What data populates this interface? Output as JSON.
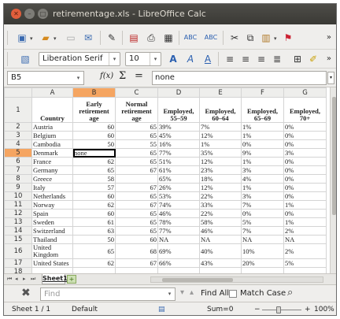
{
  "window": {
    "title": "retirementage.xls - LibreOffice Calc"
  },
  "toolbar": {
    "font_name": "Liberation Serif",
    "font_size": "10",
    "more": "»"
  },
  "formula_bar": {
    "cell_ref": "B5",
    "fx_label": "f(x)",
    "sum_label": "Σ",
    "equals_label": "=",
    "content": "none"
  },
  "grid": {
    "columns": [
      "A",
      "B",
      "C",
      "D",
      "E",
      "F",
      "G"
    ],
    "active_column": "B",
    "active_row": "5",
    "header_row": {
      "row_label": "1",
      "cells": [
        "Country",
        "Early retirement age",
        "Normal retirement age",
        "Employed, 55–59",
        "Employed, 60–64",
        "Employed, 65–69",
        "Employed, 70+"
      ]
    },
    "rows": [
      {
        "n": "2",
        "cells": [
          "Austria",
          "60",
          "65",
          "39%",
          "7%",
          "1%",
          "0%"
        ]
      },
      {
        "n": "3",
        "cells": [
          "Belgium",
          "60",
          "65",
          "45%",
          "12%",
          "1%",
          "0%"
        ]
      },
      {
        "n": "4",
        "cells": [
          "Cambodia",
          "50",
          "55",
          "16%",
          "1%",
          "0%",
          "0%"
        ]
      },
      {
        "n": "5",
        "cells": [
          "Denmark",
          "none",
          "65",
          "77%",
          "35%",
          "9%",
          "3%"
        ]
      },
      {
        "n": "6",
        "cells": [
          "France",
          "62",
          "65",
          "51%",
          "12%",
          "1%",
          "0%"
        ]
      },
      {
        "n": "7",
        "cells": [
          "Germany",
          "65",
          "67",
          "61%",
          "23%",
          "3%",
          "0%"
        ]
      },
      {
        "n": "8",
        "cells": [
          "Greece",
          "58",
          "",
          "65%",
          "18%",
          "4%",
          "0%"
        ]
      },
      {
        "n": "9",
        "cells": [
          "Italy",
          "57",
          "67",
          "26%",
          "12%",
          "1%",
          "0%"
        ]
      },
      {
        "n": "10",
        "cells": [
          "Netherlands",
          "60",
          "65",
          "53%",
          "22%",
          "3%",
          "0%"
        ]
      },
      {
        "n": "11",
        "cells": [
          "Norway",
          "62",
          "67",
          "74%",
          "33%",
          "7%",
          "1%"
        ]
      },
      {
        "n": "12",
        "cells": [
          "Spain",
          "60",
          "65",
          "46%",
          "22%",
          "0%",
          "0%"
        ]
      },
      {
        "n": "13",
        "cells": [
          "Sweden",
          "61",
          "65",
          "78%",
          "58%",
          "5%",
          "1%"
        ]
      },
      {
        "n": "14",
        "cells": [
          "Switzerland",
          "63",
          "65",
          "77%",
          "46%",
          "7%",
          "2%"
        ]
      },
      {
        "n": "15",
        "cells": [
          "Thailand",
          "50",
          "60",
          "NA",
          "NA",
          "NA",
          "NA"
        ]
      },
      {
        "n": "16",
        "cells": [
          "United Kingdom",
          "65",
          "68",
          "69%",
          "40%",
          "10%",
          "2%"
        ]
      },
      {
        "n": "17",
        "cells": [
          "United States",
          "62",
          "67",
          "66%",
          "43%",
          "20%",
          "5%"
        ]
      },
      {
        "n": "18",
        "cells": [
          "",
          "",
          "",
          "",
          "",
          "",
          ""
        ]
      }
    ]
  },
  "sheet_tabs": {
    "active": "Sheet1",
    "add_label": "+"
  },
  "find_bar": {
    "placeholder": "Find",
    "find_all": "Find All",
    "match_case": "Match Case"
  },
  "status_bar": {
    "sheet": "Sheet 1 / 1",
    "style": "Default",
    "sum": "Sum=0",
    "zoom": "100%"
  }
}
